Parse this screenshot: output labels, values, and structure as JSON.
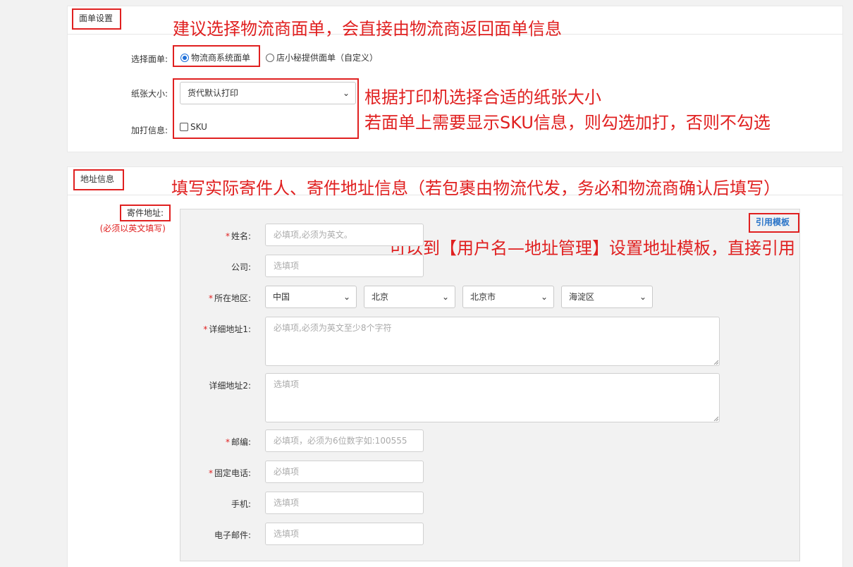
{
  "waybill_section": {
    "title": "面单设置",
    "annotation_select": "建议选择物流商面单，会直接由物流商返回面单信息",
    "select_label": "选择面单:",
    "option_carrier": "物流商系统面单",
    "option_dianxiaomi": "店小秘提供面单（自定义）",
    "paper_label": "纸张大小:",
    "paper_value": "货代默认打印",
    "extra_label": "加打信息:",
    "extra_sku": "SKU",
    "annotation_paper_line1": "根据打印机选择合适的纸张大小",
    "annotation_paper_line2": "若面单上需要显示SKU信息，则勾选加打，否则不勾选"
  },
  "address_section": {
    "title": "地址信息",
    "annotation_fill": "填写实际寄件人、寄件地址信息（若包裹由物流代发，务必和物流商确认后填写）",
    "sender_label": "寄件地址:",
    "sender_note": "(必须以英文填写)",
    "template_button": "引用模板",
    "annotation_template": "可以到【用户名—地址管理】设置地址模板，直接引用",
    "fields": {
      "name_label": "姓名:",
      "name_placeholder": "必填项,必须为英文。",
      "company_label": "公司:",
      "company_placeholder": "选填项",
      "region_label": "所在地区:",
      "country": "中国",
      "province": "北京",
      "city": "北京市",
      "district": "海淀区",
      "addr1_label": "详细地址1:",
      "addr1_placeholder": "必填项,必须为英文至少8个字符",
      "addr2_label": "详细地址2:",
      "addr2_placeholder": "选填项",
      "zip_label": "邮编:",
      "zip_placeholder": "必填项，必须为6位数字如:100555",
      "phone_label": "固定电话:",
      "phone_placeholder": "必填项",
      "mobile_label": "手机:",
      "mobile_placeholder": "选填项",
      "email_label": "电子邮件:",
      "email_placeholder": "选填项"
    }
  },
  "colors": {
    "annotation_red": "#e02020",
    "link_blue": "#2a74c8",
    "radio_blue": "#1e6fd9"
  }
}
